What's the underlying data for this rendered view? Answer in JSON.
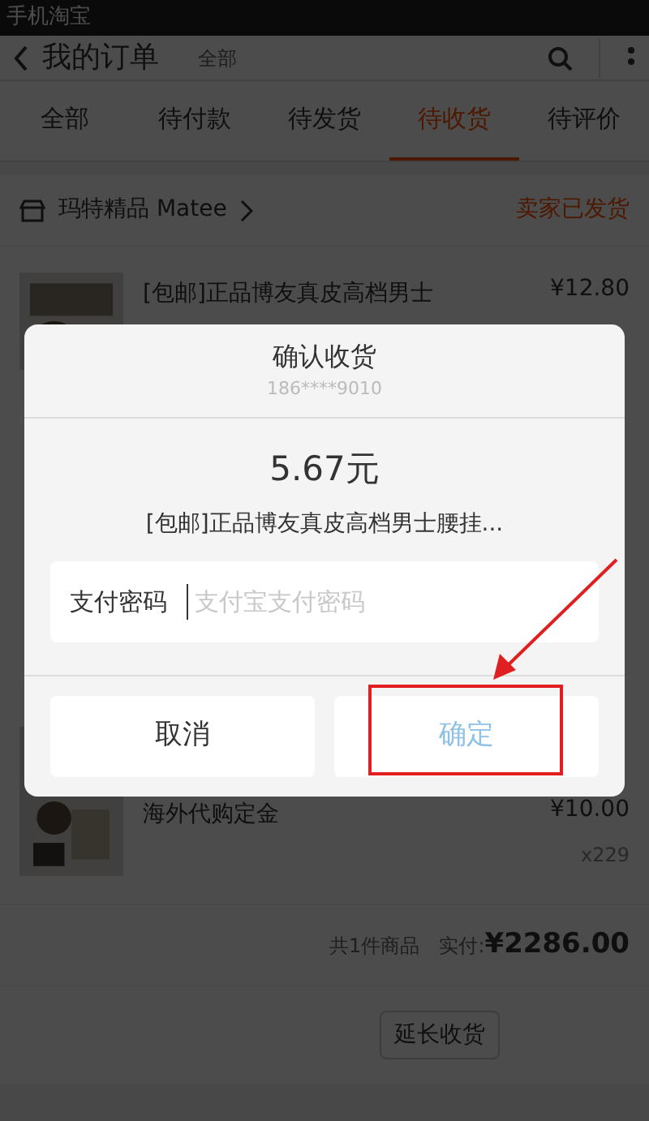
{
  "status_bar": {
    "app": "手机淘宝"
  },
  "header": {
    "title": "我的订单",
    "filter": "全部"
  },
  "tabs": [
    {
      "label": "全部",
      "selected": false
    },
    {
      "label": "待付款",
      "selected": false
    },
    {
      "label": "待发货",
      "selected": false
    },
    {
      "label": "待收货",
      "selected": true
    },
    {
      "label": "待评价",
      "selected": false
    }
  ],
  "order": {
    "shop": "玛特精品 Matee",
    "status": "卖家已发货",
    "items": [
      {
        "title": "[包邮]正品博友真皮高档男士",
        "price": "¥12.80"
      },
      {
        "title": "海外代购定金",
        "price": "¥10.00",
        "qty": "x229"
      }
    ],
    "summary": {
      "count": "共1件商品",
      "paid_label": "实付:",
      "total": "¥2286.00"
    },
    "buttons": [
      "延长收货"
    ]
  },
  "dialog": {
    "title": "确认收货",
    "account": "186****9010",
    "amount": "5.67元",
    "product": "[包邮]正品博友真皮高档男士腰挂...",
    "field": {
      "label": "支付密码",
      "placeholder": "支付宝支付密码"
    },
    "cancel": "取消",
    "confirm": {
      "label": "确定",
      "disabled": true
    }
  }
}
